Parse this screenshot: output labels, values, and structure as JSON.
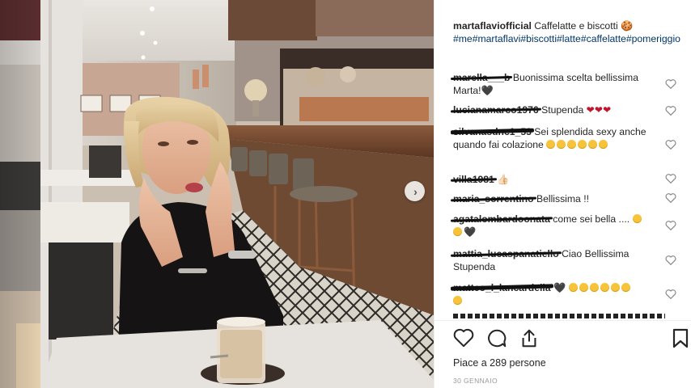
{
  "post": {
    "username": "martaflaviofficial",
    "caption_text": "Caffelatte e biscotti 🍪",
    "hashtags": "#me#martaflavi#biscotti#latte#caffelatte#pomeriggio",
    "likes_text": "Piace a 289 persone",
    "date": "30 GENNAIO"
  },
  "comments": [
    {
      "user": "marella___b",
      "text": "Buonissima scelta bellissima Marta!🖤"
    },
    {
      "user": "lucianamarco1976",
      "text": "Stupenda",
      "hearts": "❤❤❤"
    },
    {
      "user": "silvanasdnc1_53",
      "text": "Sei splendida sexy anche quando fai colazione"
    },
    {
      "user": "villa1981",
      "text": "👍🏻"
    },
    {
      "user": "maria_sorrentino",
      "text": "Bellissima !!"
    },
    {
      "user": "agatalombardoonata",
      "text": "come sei bella ....",
      "trail": "🖤"
    },
    {
      "user": "mattia_lucaspanatiello",
      "text": "Ciao Bellissima Stupenda"
    },
    {
      "user": "matteo_l_lancardella",
      "text": "🖤"
    }
  ],
  "icons": {
    "like": "heart-outline-icon",
    "comment": "speech-bubble-icon",
    "share": "share-icon",
    "save": "bookmark-icon",
    "next": "chevron-right-icon"
  },
  "colors": {
    "hashtag": "#003569",
    "heart_red": "#c0162e"
  }
}
